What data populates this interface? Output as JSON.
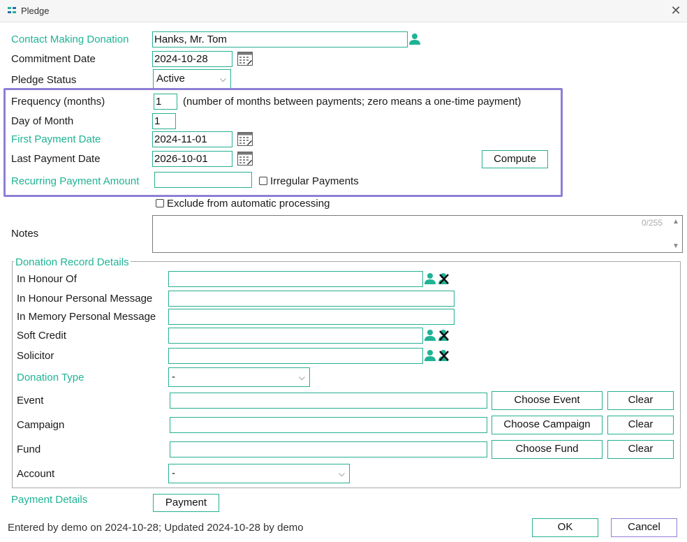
{
  "window": {
    "title": "Pledge"
  },
  "contact": {
    "label": "Contact Making Donation",
    "value": "Hanks, Mr. Tom"
  },
  "commitment": {
    "label": "Commitment Date",
    "value": "2024-10-28"
  },
  "status": {
    "label": "Pledge Status",
    "value": "Active"
  },
  "frequency": {
    "label": "Frequency (months)",
    "value": "1",
    "hint": "(number of months between payments; zero means a one-time payment)"
  },
  "day_of_month": {
    "label": "Day of Month",
    "value": "1"
  },
  "first_payment": {
    "label": "First Payment Date",
    "value": "2024-11-01"
  },
  "last_payment": {
    "label": "Last Payment Date",
    "value": "2026-10-01"
  },
  "compute_label": "Compute",
  "recurring": {
    "label": "Recurring Payment Amount",
    "value": ""
  },
  "irregular_label": "Irregular Payments",
  "exclude_label": "Exclude from automatic processing",
  "notes": {
    "label": "Notes",
    "counter": "0/255",
    "value": ""
  },
  "donation": {
    "legend": "Donation Record Details",
    "honour_of": {
      "label": "In Honour Of",
      "value": ""
    },
    "honour_msg": {
      "label": "In Honour Personal Message",
      "value": ""
    },
    "memory_msg": {
      "label": "In Memory Personal Message",
      "value": ""
    },
    "soft_credit": {
      "label": "Soft Credit",
      "value": ""
    },
    "solicitor": {
      "label": "Solicitor",
      "value": ""
    },
    "donation_type": {
      "label": "Donation Type",
      "value": "-"
    },
    "event": {
      "label": "Event",
      "value": "",
      "choose": "Choose Event",
      "clear": "Clear"
    },
    "campaign": {
      "label": "Campaign",
      "value": "",
      "choose": "Choose Campaign",
      "clear": "Clear"
    },
    "fund": {
      "label": "Fund",
      "value": "",
      "choose": "Choose Fund",
      "clear": "Clear"
    },
    "account": {
      "label": "Account",
      "value": "-"
    }
  },
  "payment": {
    "label": "Payment Details",
    "button": "Payment"
  },
  "footer": {
    "text": "Entered by demo on 2024-10-28; Updated 2024-10-28 by demo",
    "ok": "OK",
    "cancel": "Cancel"
  },
  "colors": {
    "accent": "#1fb395",
    "field_border": "#27b090",
    "highlight": "#8d7fd6"
  },
  "icons": [
    "calendar-icon",
    "person-icon",
    "clear-x-icon",
    "chevron-down-icon",
    "close-icon"
  ]
}
